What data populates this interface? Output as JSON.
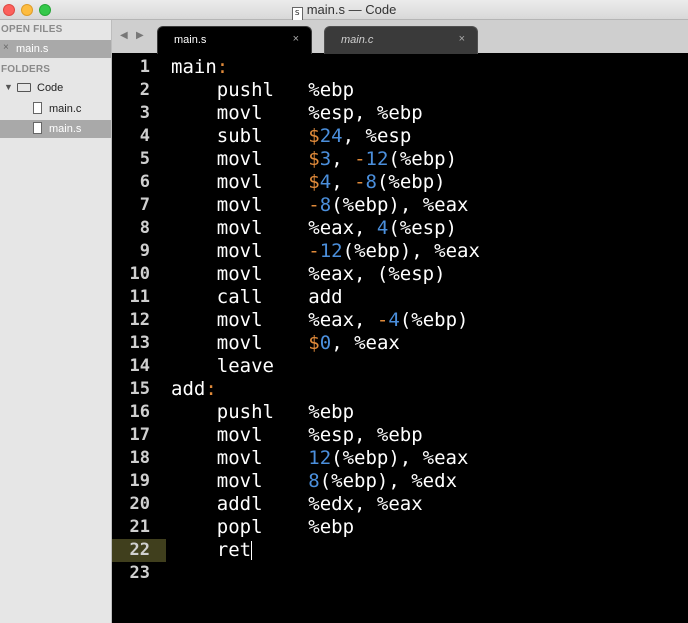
{
  "window": {
    "title": "main.s — Code",
    "doc_icon_letter": "s"
  },
  "sidebar": {
    "open_files_header": "OPEN FILES",
    "open_files": [
      {
        "label": "main.s",
        "close": "×"
      }
    ],
    "folders_header": "FOLDERS",
    "folder": {
      "label": "Code",
      "arrow": "▼"
    },
    "files": [
      {
        "label": "main.c"
      },
      {
        "label": "main.s"
      }
    ]
  },
  "tabs": {
    "nav_left": "◀",
    "nav_right": "▶",
    "items": [
      {
        "label": "main.s",
        "close": "×"
      },
      {
        "label": "main.c",
        "close": "×"
      }
    ]
  },
  "editor": {
    "highlighted_line": 22,
    "colors": {
      "label": "#ffffff",
      "colon": "#e08a3a",
      "dollar": "#e08a3a",
      "minus": "#e08a3a",
      "number": "#4b8fdc",
      "text": "#ffffff",
      "gutter_highlight": "#403f1d"
    },
    "lines": [
      {
        "n": "1",
        "tokens": [
          [
            "t",
            "main"
          ],
          [
            "c",
            ":"
          ]
        ]
      },
      {
        "n": "2",
        "tokens": [
          [
            "t",
            "    pushl   %ebp"
          ]
        ]
      },
      {
        "n": "3",
        "tokens": [
          [
            "t",
            "    movl    %esp, %ebp"
          ]
        ]
      },
      {
        "n": "4",
        "tokens": [
          [
            "t",
            "    subl    "
          ],
          [
            "d",
            "$"
          ],
          [
            "m",
            "24"
          ],
          [
            "t",
            ", %esp"
          ]
        ]
      },
      {
        "n": "5",
        "tokens": [
          [
            "t",
            "    movl    "
          ],
          [
            "d",
            "$"
          ],
          [
            "m",
            "3"
          ],
          [
            "t",
            ", "
          ],
          [
            "d",
            "-"
          ],
          [
            "m",
            "12"
          ],
          [
            "t",
            "(%ebp)"
          ]
        ]
      },
      {
        "n": "6",
        "tokens": [
          [
            "t",
            "    movl    "
          ],
          [
            "d",
            "$"
          ],
          [
            "m",
            "4"
          ],
          [
            "t",
            ", "
          ],
          [
            "d",
            "-"
          ],
          [
            "m",
            "8"
          ],
          [
            "t",
            "(%ebp)"
          ]
        ]
      },
      {
        "n": "7",
        "tokens": [
          [
            "t",
            "    movl    "
          ],
          [
            "d",
            "-"
          ],
          [
            "m",
            "8"
          ],
          [
            "t",
            "(%ebp), %eax"
          ]
        ]
      },
      {
        "n": "8",
        "tokens": [
          [
            "t",
            "    movl    %eax, "
          ],
          [
            "m",
            "4"
          ],
          [
            "t",
            "(%esp)"
          ]
        ]
      },
      {
        "n": "9",
        "tokens": [
          [
            "t",
            "    movl    "
          ],
          [
            "d",
            "-"
          ],
          [
            "m",
            "12"
          ],
          [
            "t",
            "(%ebp), %eax"
          ]
        ]
      },
      {
        "n": "10",
        "tokens": [
          [
            "t",
            "    movl    %eax, (%esp)"
          ]
        ]
      },
      {
        "n": "11",
        "tokens": [
          [
            "t",
            "    call    add"
          ]
        ]
      },
      {
        "n": "12",
        "tokens": [
          [
            "t",
            "    movl    %eax, "
          ],
          [
            "d",
            "-"
          ],
          [
            "m",
            "4"
          ],
          [
            "t",
            "(%ebp)"
          ]
        ]
      },
      {
        "n": "13",
        "tokens": [
          [
            "t",
            "    movl    "
          ],
          [
            "d",
            "$"
          ],
          [
            "m",
            "0"
          ],
          [
            "t",
            ", %eax"
          ]
        ]
      },
      {
        "n": "14",
        "tokens": [
          [
            "t",
            "    leave"
          ]
        ]
      },
      {
        "n": "15",
        "tokens": [
          [
            "t",
            "add"
          ],
          [
            "c",
            ":"
          ]
        ]
      },
      {
        "n": "16",
        "tokens": [
          [
            "t",
            "    pushl   %ebp"
          ]
        ]
      },
      {
        "n": "17",
        "tokens": [
          [
            "t",
            "    movl    %esp, %ebp"
          ]
        ]
      },
      {
        "n": "18",
        "tokens": [
          [
            "t",
            "    movl    "
          ],
          [
            "m",
            "12"
          ],
          [
            "t",
            "(%ebp), %eax"
          ]
        ]
      },
      {
        "n": "19",
        "tokens": [
          [
            "t",
            "    movl    "
          ],
          [
            "m",
            "8"
          ],
          [
            "t",
            "(%ebp), %edx"
          ]
        ]
      },
      {
        "n": "20",
        "tokens": [
          [
            "t",
            "    addl    %edx, %eax"
          ]
        ]
      },
      {
        "n": "21",
        "tokens": [
          [
            "t",
            "    popl    %ebp"
          ]
        ]
      },
      {
        "n": "22",
        "tokens": [
          [
            "t",
            "    ret"
          ]
        ]
      },
      {
        "n": "23",
        "tokens": []
      }
    ]
  }
}
